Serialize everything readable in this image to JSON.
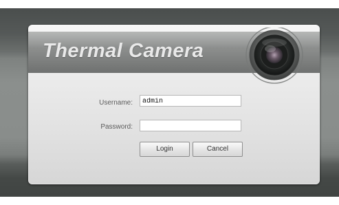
{
  "banner": {
    "title": "Thermal Camera",
    "logo_icon": "camera-lens-icon"
  },
  "login_form": {
    "username_label": "Username:",
    "username_value": "admin",
    "password_label": "Password:",
    "password_value": "",
    "login_label": "Login",
    "cancel_label": "Cancel"
  },
  "colors": {
    "background": "#5e6260",
    "panel": "#e6e6e6",
    "banner": "#8a8c8b",
    "banner_title": "#e9e9e9",
    "label_text": "#5c5c5c"
  }
}
